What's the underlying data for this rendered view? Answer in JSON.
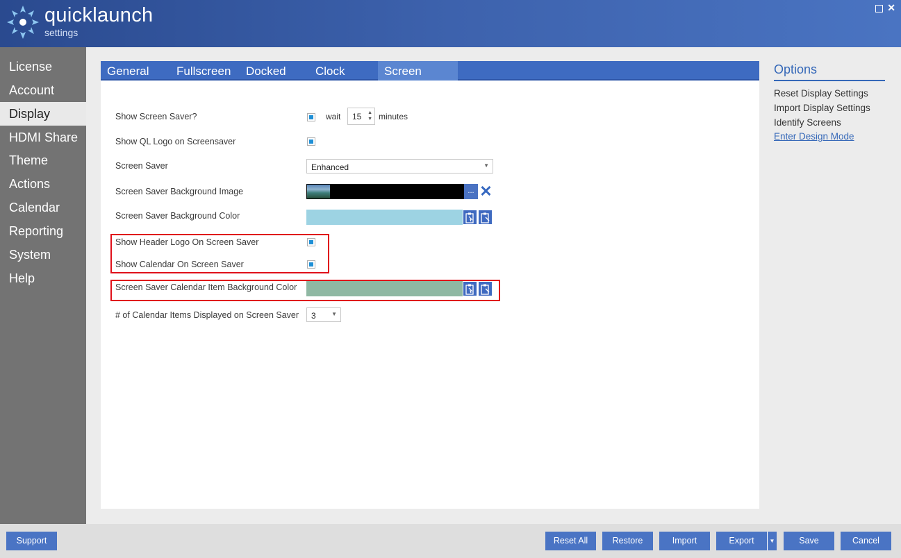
{
  "header": {
    "brand_main": "quicklaunch",
    "brand_sub": "settings",
    "max_icon": "maximize-icon",
    "close_icon": "close-icon",
    "close_glyph": "✕"
  },
  "sidebar": {
    "items": [
      {
        "label": "License"
      },
      {
        "label": "Account"
      },
      {
        "label": "Display",
        "active": true
      },
      {
        "label": "HDMI Share"
      },
      {
        "label": "Theme"
      },
      {
        "label": "Actions"
      },
      {
        "label": "Calendar"
      },
      {
        "label": "Reporting"
      },
      {
        "label": "System"
      },
      {
        "label": "Help"
      }
    ]
  },
  "tabs": [
    {
      "label": "General"
    },
    {
      "label": "Fullscreen"
    },
    {
      "label": "Docked"
    },
    {
      "label": "Clock"
    },
    {
      "label": "Screen Saver",
      "active": true
    }
  ],
  "form": {
    "show_screensaver": {
      "label": "Show Screen Saver?",
      "checked": true,
      "wait_label": "wait",
      "wait_value": "15",
      "minutes_label": "minutes"
    },
    "show_ql_logo": {
      "label": "Show QL Logo on Screensaver",
      "checked": true
    },
    "screen_saver": {
      "label": "Screen Saver",
      "value": "Enhanced"
    },
    "bg_image": {
      "label": "Screen Saver Background Image",
      "browse": "..."
    },
    "bg_color": {
      "label": "Screen Saver Background Color",
      "color": "#9dd3e3"
    },
    "show_header_logo": {
      "label": "Show Header Logo On Screen Saver",
      "checked": true
    },
    "show_calendar": {
      "label": "Show Calendar On Screen Saver",
      "checked": true
    },
    "calendar_item_bg_color": {
      "label": "Screen Saver Calendar Item Background Color",
      "color": "#8fb8a3"
    },
    "calendar_items_count": {
      "label": "# of Calendar Items Displayed on Screen Saver",
      "value": "3"
    }
  },
  "options": {
    "title": "Options",
    "links": [
      "Reset Display Settings",
      "Import Display Settings",
      "Identify Screens",
      "Enter Design Mode"
    ]
  },
  "footer": {
    "support": "Support",
    "reset_all": "Reset All",
    "restore": "Restore",
    "import": "Import",
    "export": "Export",
    "save": "Save",
    "cancel": "Cancel"
  },
  "colors": {
    "accent": "#3e6bc1",
    "highlight_box": "#e0101a"
  }
}
